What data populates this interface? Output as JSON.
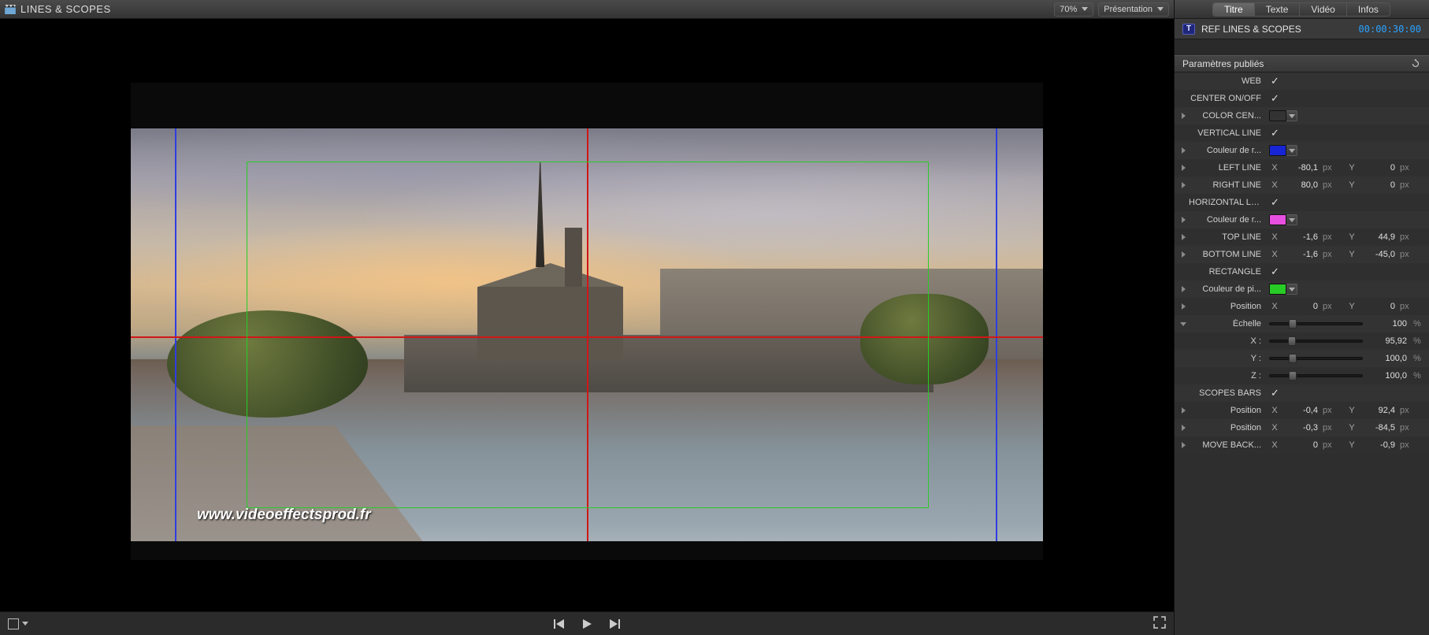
{
  "viewer": {
    "title": "LINES & SCOPES",
    "zoom": "70%",
    "presentation_label": "Présentation",
    "watermark": "www.videoeffectsprod.fr"
  },
  "inspector": {
    "tabs": {
      "t1": "Titre",
      "t2": "Texte",
      "t3": "Vidéo",
      "t4": "Infos",
      "active": "t1"
    },
    "title_icon": "T",
    "title": "REF LINES & SCOPES",
    "timecode": "00:00:30:00",
    "section_header": "Paramètres publiés"
  },
  "params": {
    "web": {
      "label": "WEB",
      "checked": true
    },
    "center_onoff": {
      "label": "CENTER ON/OFF",
      "checked": true
    },
    "color_center": {
      "label": "COLOR CEN...",
      "swatch": "#d01717"
    },
    "vertical_line": {
      "label": "VERTICAL LINE",
      "checked": true
    },
    "color_vertical": {
      "label": "Couleur de r...",
      "swatch": "#1825d4"
    },
    "left_line": {
      "label": "LEFT LINE",
      "x": "-80,1",
      "y": "0"
    },
    "right_line": {
      "label": "RIGHT LINE",
      "x": "80,0",
      "y": "0"
    },
    "horizontal_line": {
      "label": "HORIZONTAL LINE",
      "checked": true
    },
    "color_horiz": {
      "label": "Couleur de r...",
      "swatch": "#e74fe0"
    },
    "top_line": {
      "label": "TOP LINE",
      "x": "-1,6",
      "y": "44,9"
    },
    "bottom_line": {
      "label": "BOTTOM LINE",
      "x": "-1,6",
      "y": "-45,0"
    },
    "rectangle": {
      "label": "RECTANGLE",
      "checked": true
    },
    "color_rect": {
      "label": "Couleur de pi...",
      "swatch": "#28cc27"
    },
    "rect_pos": {
      "label": "Position",
      "x": "0",
      "y": "0"
    },
    "echelle": {
      "label": "Échelle",
      "val": "100",
      "pct": 25
    },
    "echelle_x": {
      "label": "X :",
      "val": "95,92",
      "pct": 24
    },
    "echelle_y": {
      "label": "Y :",
      "val": "100,0",
      "pct": 25
    },
    "echelle_z": {
      "label": "Z :",
      "val": "100,0",
      "pct": 25
    },
    "scopes_bars": {
      "label": "SCOPES BARS",
      "checked": true
    },
    "scopes_pos1": {
      "label": "Position",
      "x": "-0,4",
      "y": "92,4"
    },
    "scopes_pos2": {
      "label": "Position",
      "x": "-0,3",
      "y": "-84,5"
    },
    "move_back": {
      "label": "MOVE BACK...",
      "x": "0",
      "y": "-0,9"
    }
  },
  "units": {
    "px": "px",
    "pct": "%",
    "X": "X",
    "Y": "Y"
  }
}
